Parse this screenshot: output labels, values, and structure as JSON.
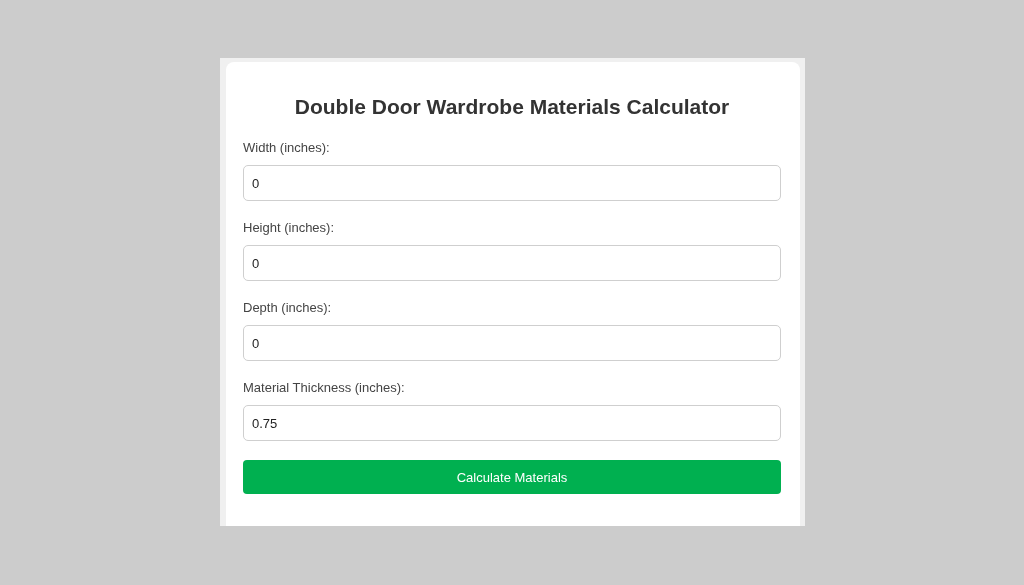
{
  "title": "Double Door Wardrobe Materials Calculator",
  "fields": [
    {
      "label": "Width (inches):",
      "value": "0"
    },
    {
      "label": "Height (inches):",
      "value": "0"
    },
    {
      "label": "Depth (inches):",
      "value": "0"
    },
    {
      "label": "Material Thickness (inches):",
      "value": "0.75"
    }
  ],
  "button": "Calculate Materials"
}
